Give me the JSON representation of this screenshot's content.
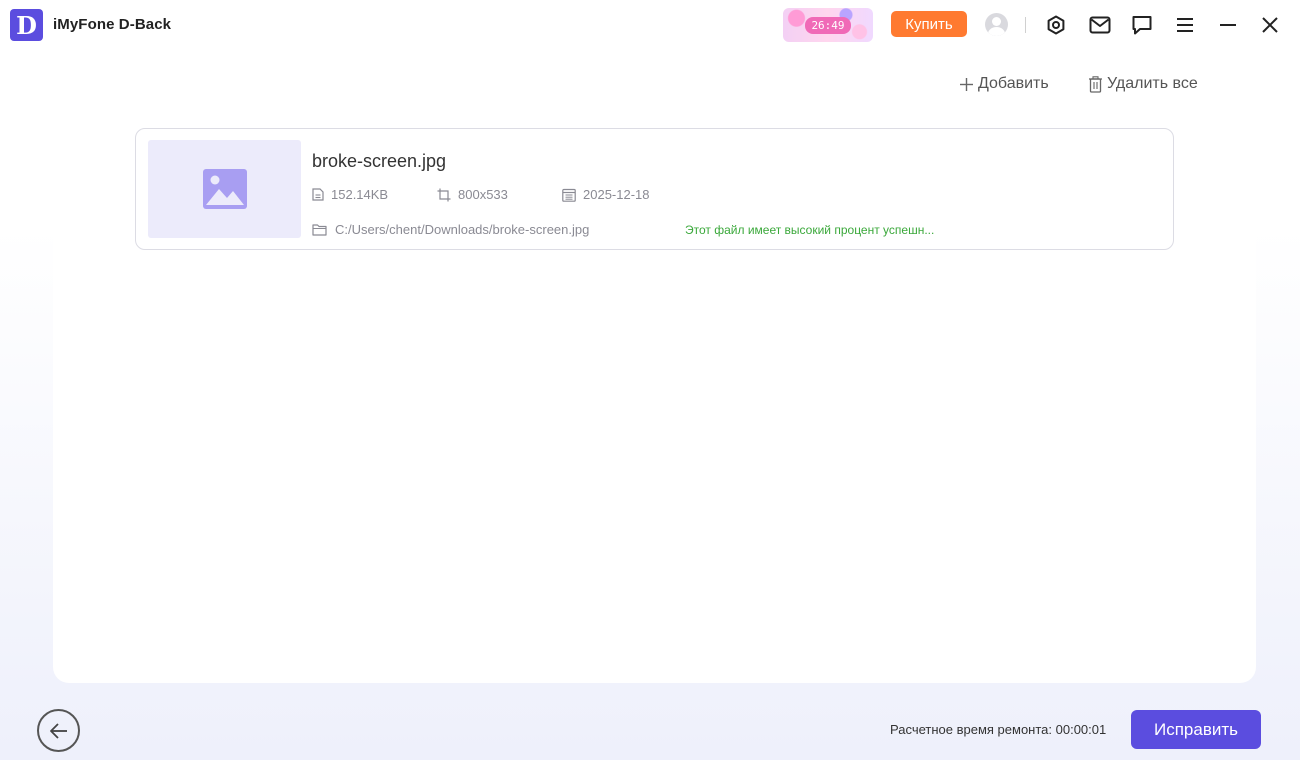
{
  "app": {
    "logo_letter": "D",
    "title": "iMyFone D-Back"
  },
  "header": {
    "promo_timer": "26:49",
    "buy_label": "Купить",
    "icons": [
      "settings-icon",
      "mail-icon",
      "feedback-icon",
      "menu-icon",
      "minimize-icon",
      "close-icon"
    ]
  },
  "toolbar": {
    "add_label": "Добавить",
    "delete_all_label": "Удалить все"
  },
  "files": [
    {
      "name": "broke-screen.jpg",
      "size": "152.14KB",
      "dimensions": "800x533",
      "date": "2025-12-18",
      "path": "C:/Users/chent/Downloads/broke-screen.jpg",
      "status": "Этот файл имеет высокий процент успешн..."
    }
  ],
  "footer": {
    "repair_time_label": "Расчетное время ремонта: 00:00:01",
    "repair_button_label": "Исправить"
  },
  "colors": {
    "accent": "#5b4ddf",
    "buy": "#ff7a30",
    "success": "#3aa83a"
  }
}
